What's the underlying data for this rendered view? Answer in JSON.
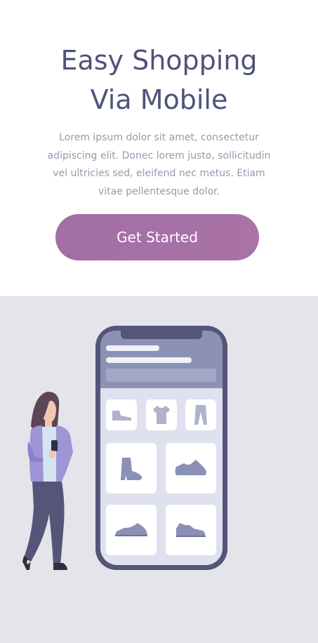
{
  "hero": {
    "title_line1": "Easy Shopping",
    "title_line2": "Via Mobile",
    "description": "Lorem ipsum dolor sit amet, consectetur adipiscing elit. Donec lorem justo, sollicitudin vel ultricies sed, eleifend nec metus. Etiam vitae pellentesque dolor.",
    "cta_label": "Get Started"
  },
  "colors": {
    "title": "#4f527a",
    "text": "#9b98ad",
    "button": "#a973a7",
    "illustration_bg": "#e5e4ea",
    "phone_frame": "#55557a",
    "phone_header": "#8c92b4",
    "product_icon": "#8a90b6"
  },
  "illustration": {
    "product_icons": [
      "shoe-icon",
      "tshirt-icon",
      "pants-icon",
      "boot-icon",
      "sneaker-icon",
      "flat-shoe-icon",
      "sneaker-icon"
    ]
  }
}
